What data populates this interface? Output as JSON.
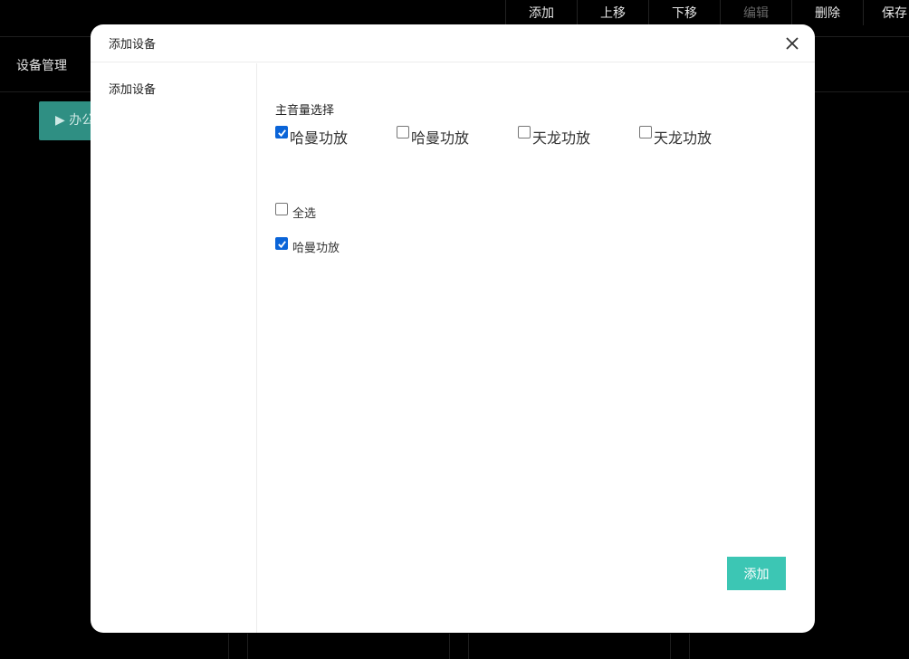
{
  "toolbar": {
    "buttons": [
      {
        "label": "添加",
        "disabled": false
      },
      {
        "label": "上移",
        "disabled": false
      },
      {
        "label": "下移",
        "disabled": false
      },
      {
        "label": "编辑",
        "disabled": true
      },
      {
        "label": "删除",
        "disabled": false
      },
      {
        "label": "保存",
        "disabled": false
      }
    ]
  },
  "background": {
    "page_title": "设备管理",
    "tree_button_label": "▶ 办公"
  },
  "modal": {
    "title": "添加设备",
    "sidebar_item": "添加设备",
    "section_label": "主音量选择",
    "options": [
      {
        "label": "哈曼功放",
        "checked": true
      },
      {
        "label": "哈曼功放",
        "checked": false
      },
      {
        "label": "天龙功放",
        "checked": false
      },
      {
        "label": "天龙功放",
        "checked": false
      }
    ],
    "select_all_label": "全选",
    "select_all_checked": false,
    "selected_item_label": "哈曼功放",
    "selected_item_checked": true,
    "add_button_label": "添加"
  },
  "colors": {
    "accent": "#3cc6b4",
    "checkbox_checked": "#0a64d8",
    "background": "#000000"
  }
}
